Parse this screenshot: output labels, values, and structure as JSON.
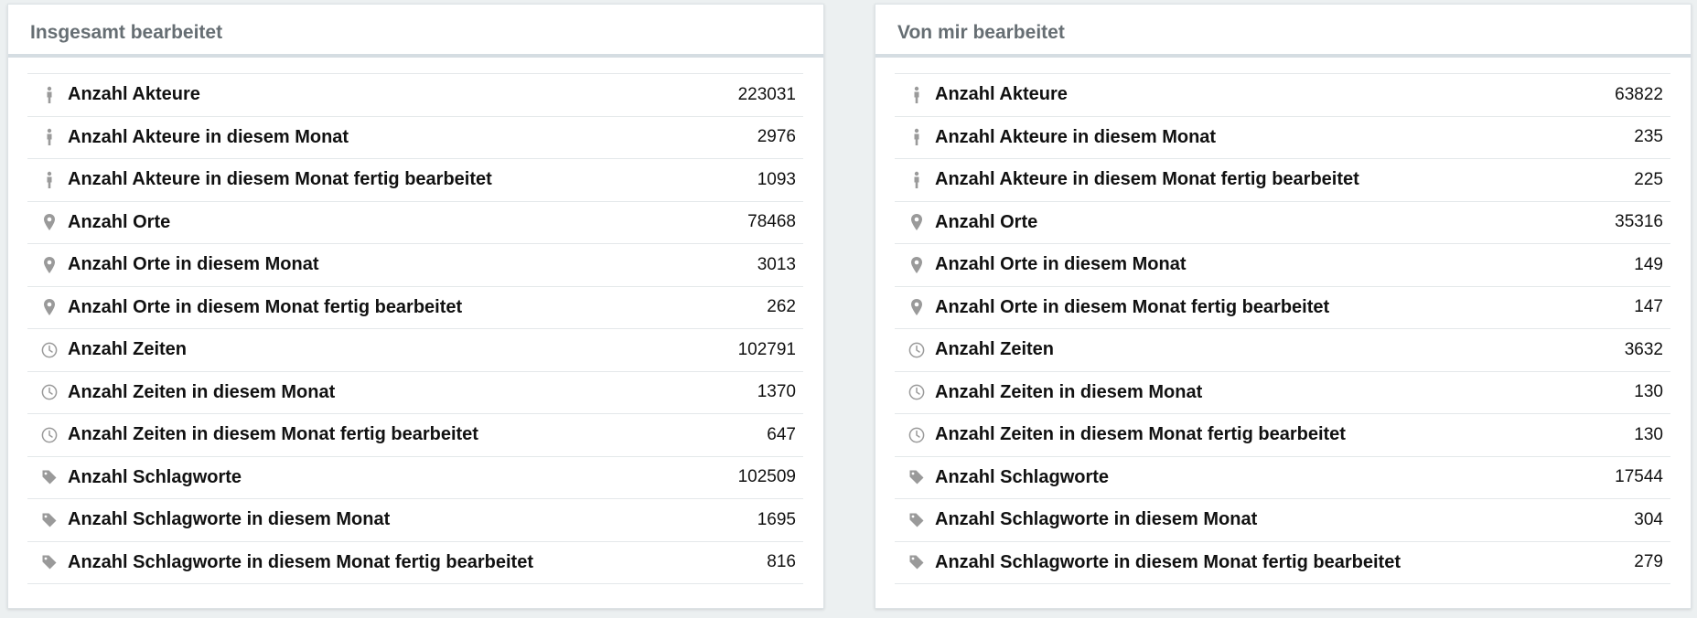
{
  "panels": [
    {
      "title": "Insgesamt bearbeitet",
      "rows": [
        {
          "icon": "person-icon",
          "label": "Anzahl Akteure",
          "value": "223031"
        },
        {
          "icon": "person-icon",
          "label": "Anzahl Akteure in diesem Monat",
          "value": "2976"
        },
        {
          "icon": "person-icon",
          "label": "Anzahl Akteure in diesem Monat fertig bearbeitet",
          "value": "1093"
        },
        {
          "icon": "map-marker-icon",
          "label": "Anzahl Orte",
          "value": "78468"
        },
        {
          "icon": "map-marker-icon",
          "label": "Anzahl Orte in diesem Monat",
          "value": "3013"
        },
        {
          "icon": "map-marker-icon",
          "label": "Anzahl Orte in diesem Monat fertig bearbeitet",
          "value": "262"
        },
        {
          "icon": "clock-icon",
          "label": "Anzahl Zeiten",
          "value": "102791"
        },
        {
          "icon": "clock-icon",
          "label": "Anzahl Zeiten in diesem Monat",
          "value": "1370"
        },
        {
          "icon": "clock-icon",
          "label": "Anzahl Zeiten in diesem Monat fertig bearbeitet",
          "value": "647"
        },
        {
          "icon": "tag-icon",
          "label": "Anzahl Schlagworte",
          "value": "102509"
        },
        {
          "icon": "tag-icon",
          "label": "Anzahl Schlagworte in diesem Monat",
          "value": "1695"
        },
        {
          "icon": "tag-icon",
          "label": "Anzahl Schlagworte in diesem Monat fertig bearbeitet",
          "value": "816"
        }
      ]
    },
    {
      "title": "Von mir bearbeitet",
      "rows": [
        {
          "icon": "person-icon",
          "label": "Anzahl Akteure",
          "value": "63822"
        },
        {
          "icon": "person-icon",
          "label": "Anzahl Akteure in diesem Monat",
          "value": "235"
        },
        {
          "icon": "person-icon",
          "label": "Anzahl Akteure in diesem Monat fertig bearbeitet",
          "value": "225"
        },
        {
          "icon": "map-marker-icon",
          "label": "Anzahl Orte",
          "value": "35316"
        },
        {
          "icon": "map-marker-icon",
          "label": "Anzahl Orte in diesem Monat",
          "value": "149"
        },
        {
          "icon": "map-marker-icon",
          "label": "Anzahl Orte in diesem Monat fertig bearbeitet",
          "value": "147"
        },
        {
          "icon": "clock-icon",
          "label": "Anzahl Zeiten",
          "value": "3632"
        },
        {
          "icon": "clock-icon",
          "label": "Anzahl Zeiten in diesem Monat",
          "value": "130"
        },
        {
          "icon": "clock-icon",
          "label": "Anzahl Zeiten in diesem Monat fertig bearbeitet",
          "value": "130"
        },
        {
          "icon": "tag-icon",
          "label": "Anzahl Schlagworte",
          "value": "17544"
        },
        {
          "icon": "tag-icon",
          "label": "Anzahl Schlagworte in diesem Monat",
          "value": "304"
        },
        {
          "icon": "tag-icon",
          "label": "Anzahl Schlagworte in diesem Monat fertig bearbeitet",
          "value": "279"
        }
      ]
    }
  ],
  "colors": {
    "icon": "#9a9a9a",
    "header_text": "#666e73",
    "row_text": "#111111",
    "background": "#ecf0f1"
  }
}
